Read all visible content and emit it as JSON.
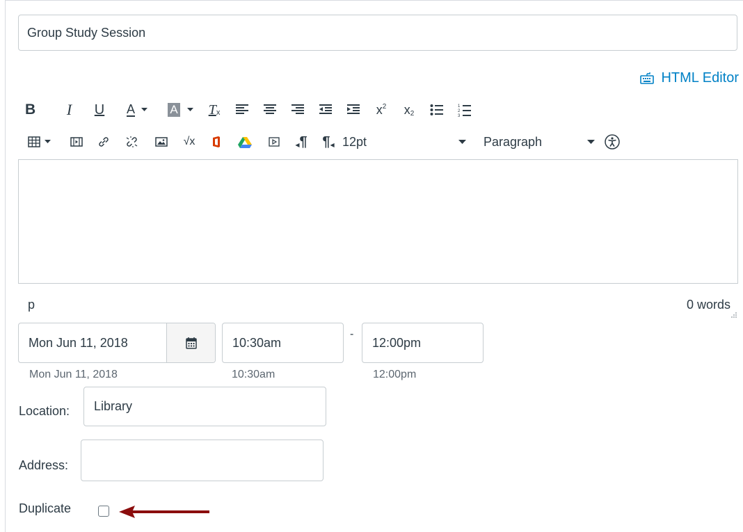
{
  "event": {
    "title_value": "Group Study Session"
  },
  "editor": {
    "html_editor_label": "HTML Editor",
    "font_size": "12pt",
    "block_format": "Paragraph",
    "status_path": "p",
    "word_count": "0 words"
  },
  "schedule": {
    "date_value": "Mon Jun 11, 2018",
    "date_hint": "Mon Jun 11, 2018",
    "start_value": "10:30am",
    "start_hint": "10:30am",
    "separator": "-",
    "end_value": "12:00pm",
    "end_hint": "12:00pm"
  },
  "location": {
    "label": "Location:",
    "value": "Library"
  },
  "address": {
    "label": "Address:",
    "value": ""
  },
  "duplicate": {
    "label": "Duplicate",
    "checked": false
  },
  "colors": {
    "link": "#0081c6",
    "arrow": "#8b0d0d",
    "border": "#c7cdd1",
    "text": "#2d3b45"
  },
  "icons": {
    "toolbar_row1": [
      "bold-icon",
      "italic-icon",
      "underline-icon",
      "text-color-icon",
      "background-color-icon",
      "clear-formatting-icon",
      "align-left-icon",
      "align-center-icon",
      "align-right-icon",
      "outdent-icon",
      "indent-icon",
      "superscript-icon",
      "subscript-icon",
      "bullet-list-icon",
      "numbered-list-icon"
    ],
    "toolbar_row2": [
      "table-icon",
      "media-icon",
      "link-icon",
      "unlink-icon",
      "image-icon",
      "math-icon",
      "office365-icon",
      "google-drive-icon",
      "embed-icon",
      "ltr-icon",
      "rtl-icon",
      "accessibility-checker-icon"
    ],
    "other": [
      "keyboard-icon",
      "calendar-icon",
      "arrow-icon"
    ]
  }
}
